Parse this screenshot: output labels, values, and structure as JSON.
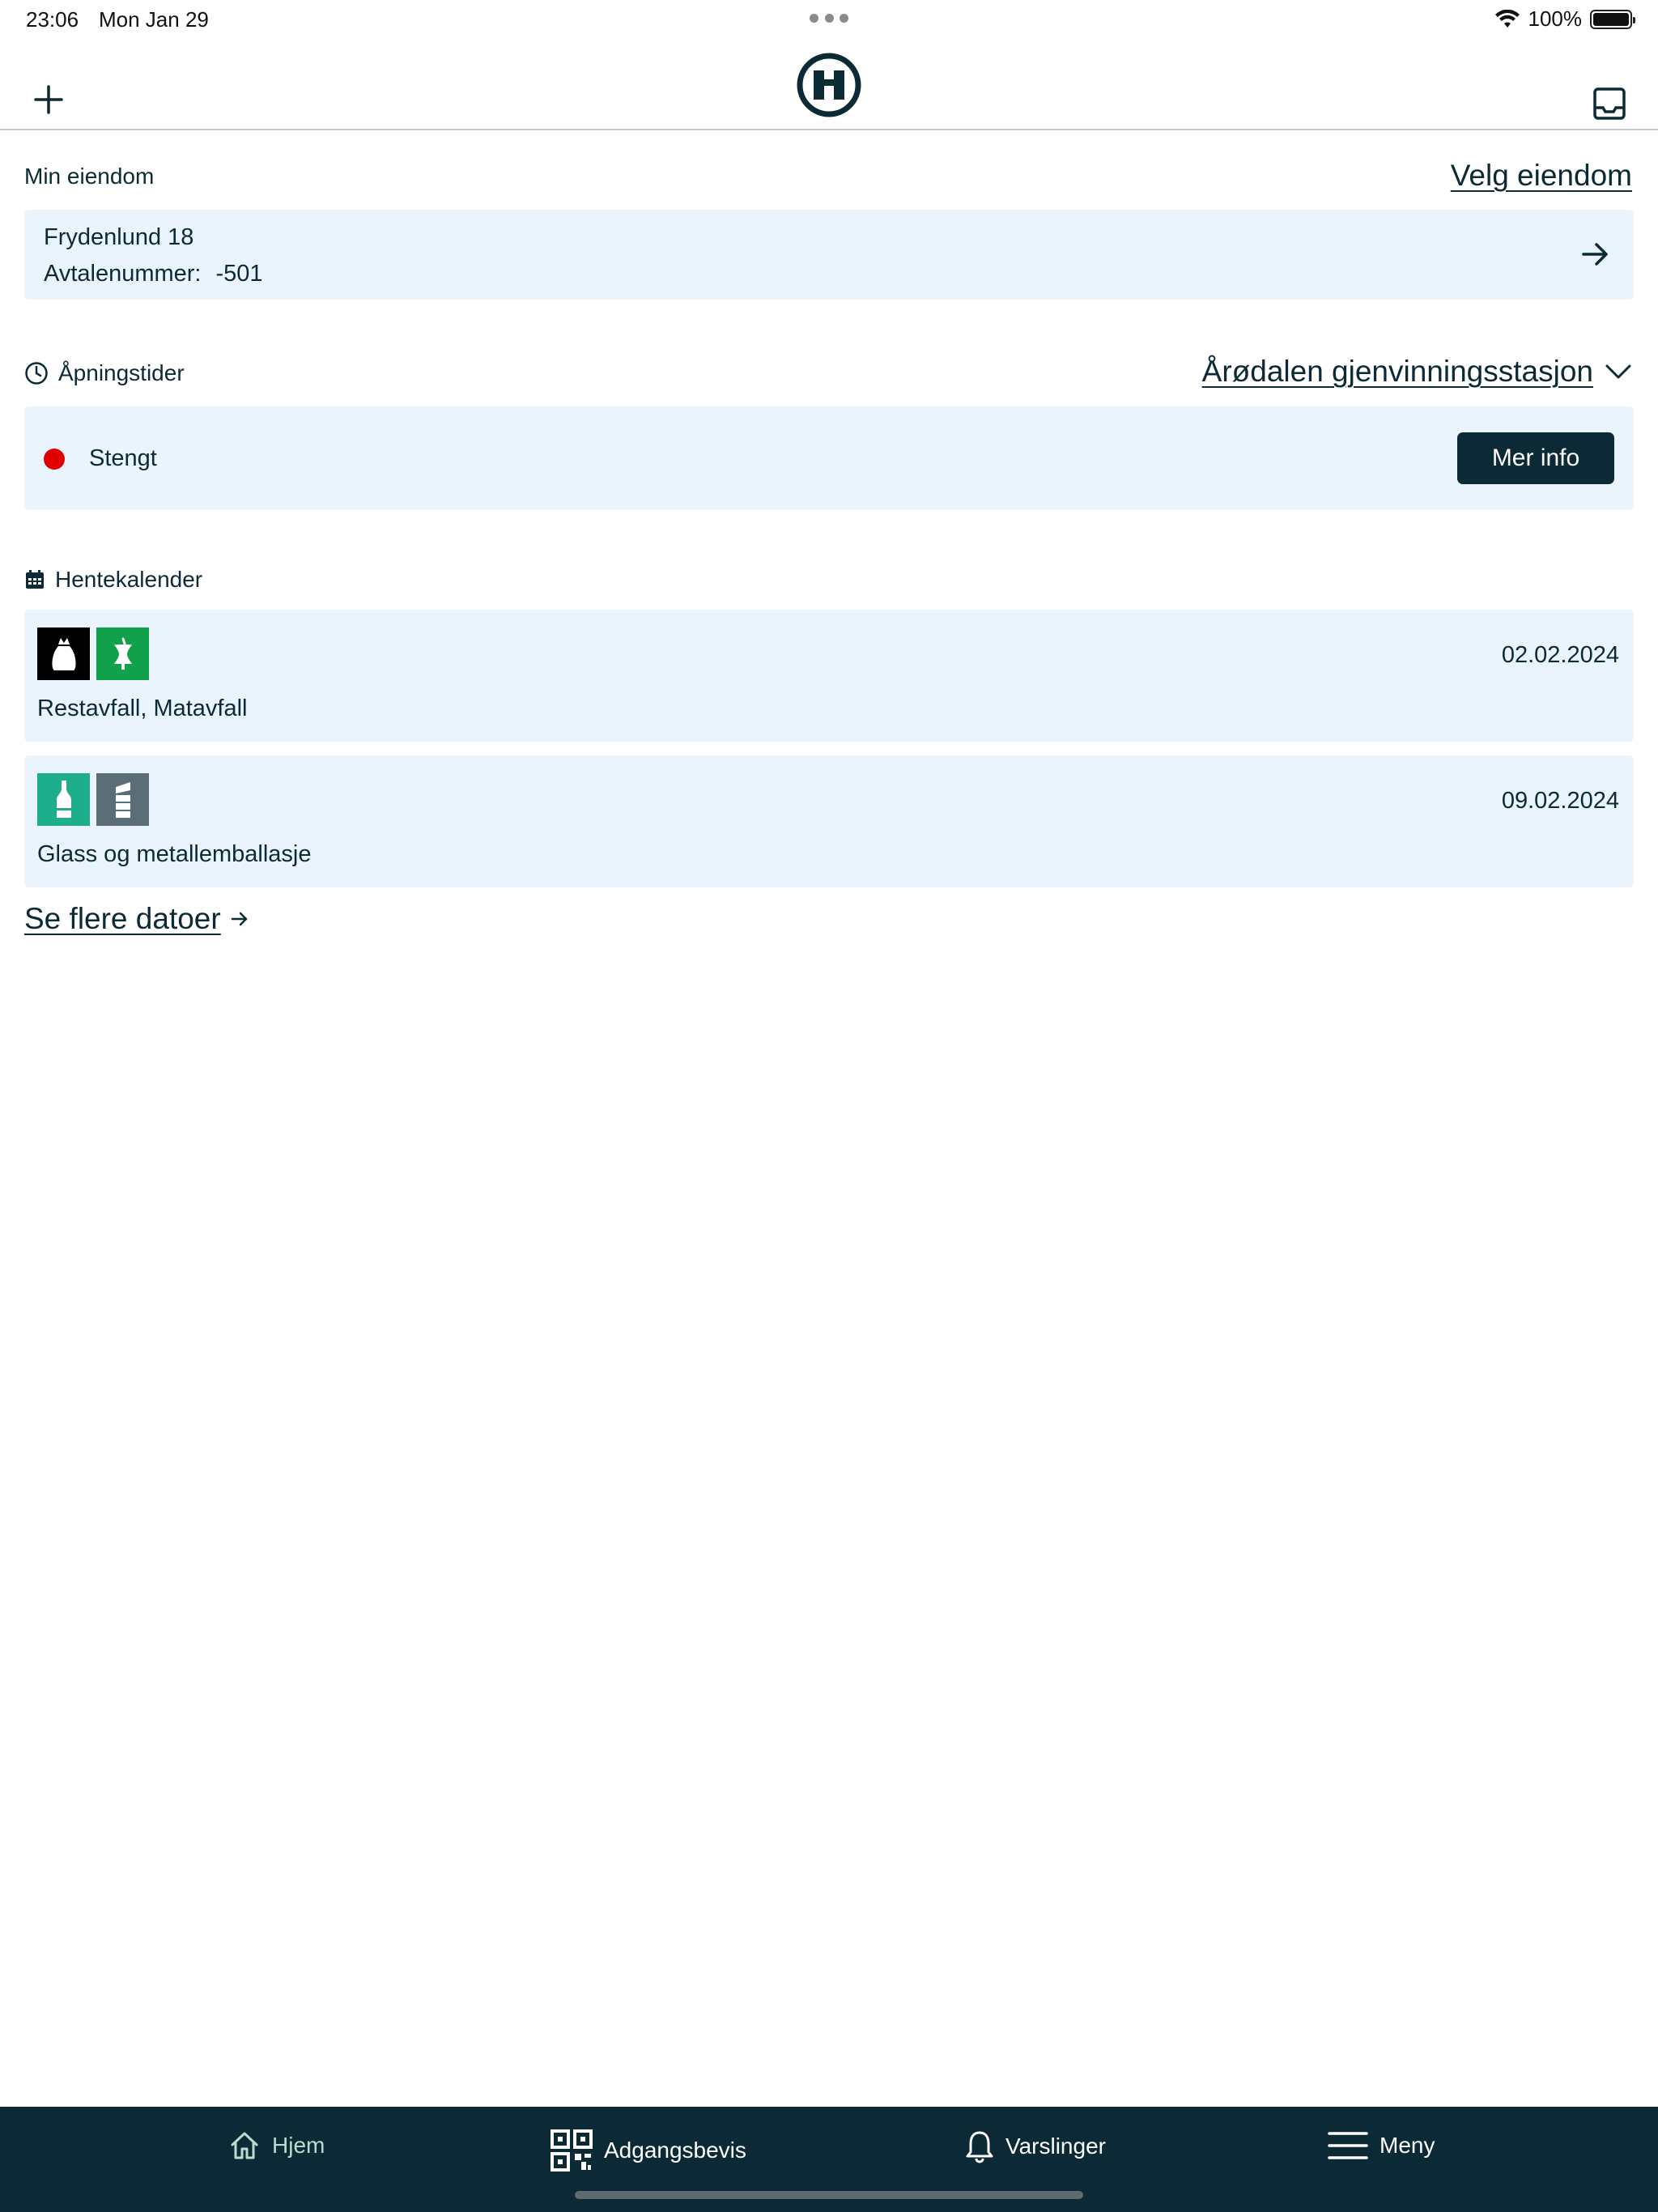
{
  "status_bar": {
    "time": "23:06",
    "date": "Mon Jan 29",
    "battery": "100%"
  },
  "header": {
    "add_icon": "plus-icon",
    "logo_icon": "app-logo",
    "inbox_icon": "inbox-icon"
  },
  "property": {
    "section_label": "Min eiendom",
    "select_link": "Velg eiendom",
    "address": "Frydenlund 18",
    "agreement_label": "Avtalenummer:",
    "agreement_number": "-501"
  },
  "opening_hours": {
    "section_label": "Åpningstider",
    "station": "Årødalen gjenvinningsstasjon",
    "status": "Stengt",
    "status_color": "#e00000",
    "more_button": "Mer info"
  },
  "calendar": {
    "section_label": "Hentekalender",
    "items": [
      {
        "date": "02.02.2024",
        "label": "Restavfall, Matavfall",
        "icons": [
          {
            "name": "residual-waste-icon",
            "color": "#000000"
          },
          {
            "name": "food-waste-icon",
            "color": "#12a14b"
          }
        ]
      },
      {
        "date": "09.02.2024",
        "label": "Glass og metallemballasje",
        "icons": [
          {
            "name": "glass-bottle-icon",
            "color": "#1fae8b"
          },
          {
            "name": "metal-can-icon",
            "color": "#5b6e78"
          }
        ]
      }
    ],
    "more_link": "Se flere datoer"
  },
  "tabbar": {
    "tabs": [
      {
        "label": "Hjem",
        "icon": "home-icon",
        "active": true
      },
      {
        "label": "Adgangsbevis",
        "icon": "qr-code-icon",
        "active": false
      },
      {
        "label": "Varslinger",
        "icon": "bell-icon",
        "active": false
      },
      {
        "label": "Meny",
        "icon": "menu-icon",
        "active": false
      }
    ]
  },
  "colors": {
    "primary": "#0b2a35",
    "card_background": "#eaf4fd",
    "active_tab": "#b9dcd0"
  }
}
